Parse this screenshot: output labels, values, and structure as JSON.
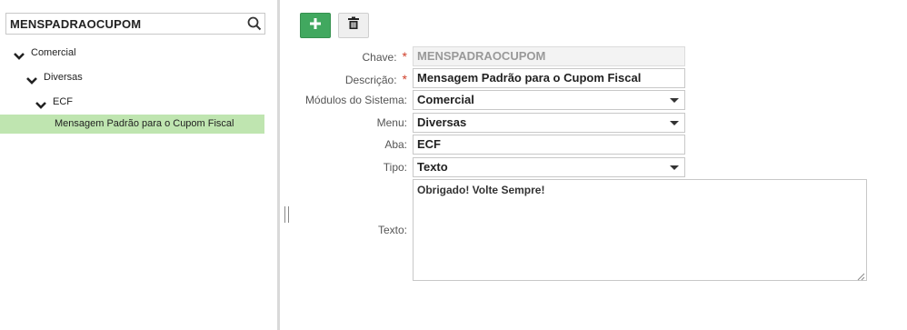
{
  "search": {
    "value": "MENSPADRAOCUPOM"
  },
  "tree": {
    "nodes": [
      {
        "label": "Comercial"
      },
      {
        "label": "Diversas"
      },
      {
        "label": "ECF"
      },
      {
        "label": "Mensagem Padrão para o Cupom Fiscal"
      }
    ]
  },
  "toolbar": {
    "add_icon": "plus-icon",
    "delete_icon": "trash-icon",
    "add_color": "#41a85f"
  },
  "form": {
    "chave": {
      "label": "Chave:",
      "value": "MENSPADRAOCUPOM",
      "required": "*"
    },
    "descricao": {
      "label": "Descrição:",
      "value": "Mensagem Padrão para o Cupom Fiscal",
      "required": "*"
    },
    "modulos": {
      "label": "Módulos do Sistema:",
      "value": "Comercial"
    },
    "menu": {
      "label": "Menu:",
      "value": "Diversas"
    },
    "aba": {
      "label": "Aba:",
      "value": "ECF"
    },
    "tipo": {
      "label": "Tipo:",
      "value": "Texto"
    },
    "texto": {
      "label": "Texto:",
      "value": "Obrigado! Volte Sempre!"
    }
  },
  "colors": {
    "selected_row": "#bfe5b0",
    "required_marker": "#d0402b"
  }
}
